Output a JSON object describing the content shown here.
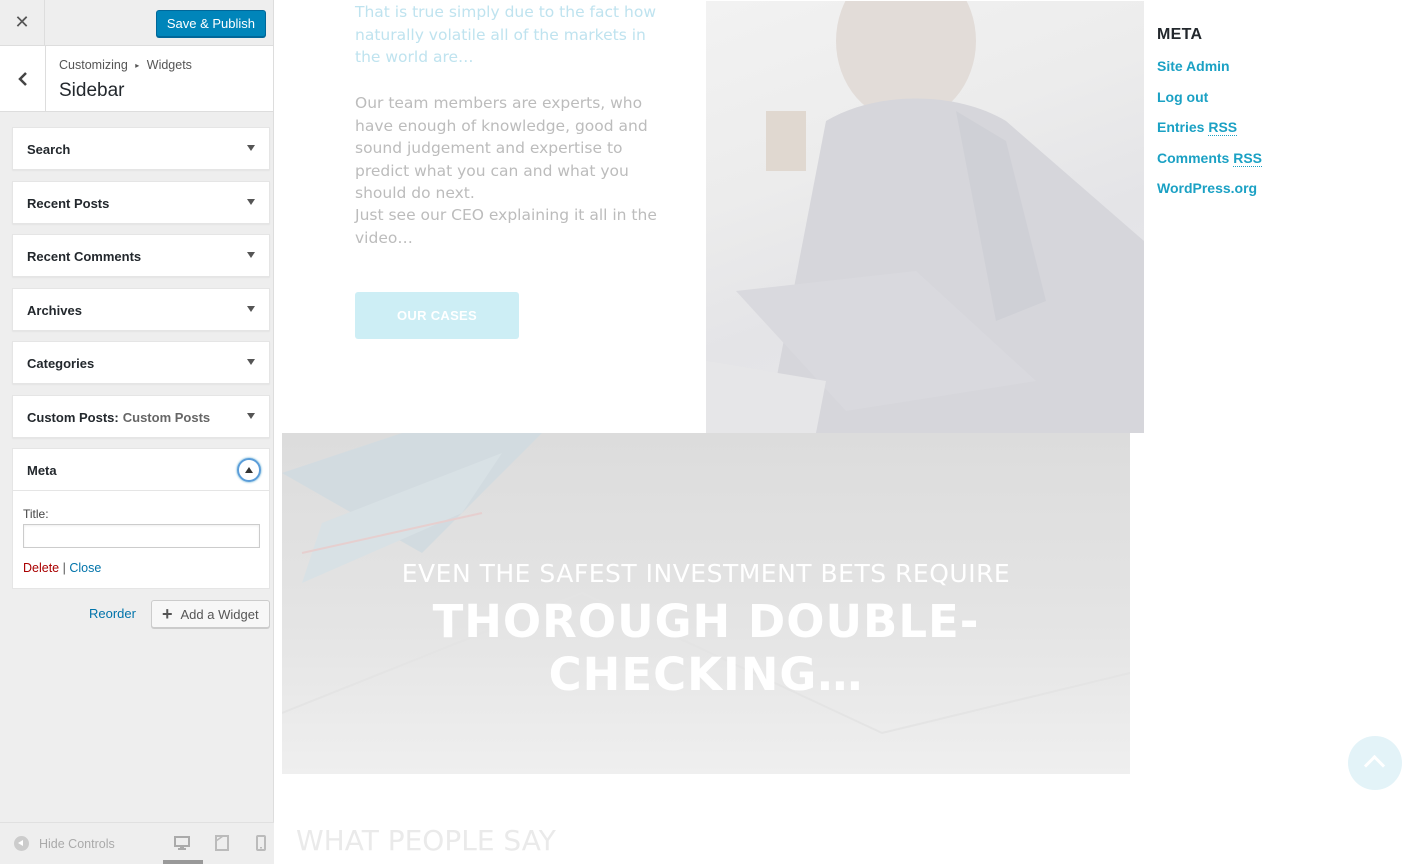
{
  "customizer": {
    "publish_label": "Save & Publish",
    "breadcrumb": {
      "root": "Customizing",
      "separator": "▸",
      "section": "Widgets"
    },
    "section_heading": "Sidebar",
    "widgets": [
      {
        "title": "Search",
        "subtitle": ""
      },
      {
        "title": "Recent Posts",
        "subtitle": ""
      },
      {
        "title": "Recent Comments",
        "subtitle": ""
      },
      {
        "title": "Archives",
        "subtitle": ""
      },
      {
        "title": "Categories",
        "subtitle": ""
      },
      {
        "title": "Custom Posts:",
        "subtitle": "Custom Posts"
      }
    ],
    "meta_widget": {
      "title": "Meta",
      "field_label": "Title:",
      "field_value": "",
      "delete_label": "Delete",
      "divider": "|",
      "close_label": "Close"
    },
    "reorder_label": "Reorder",
    "add_widget_label": "Add a Widget",
    "hide_controls_label": "Hide Controls",
    "accent_color": "#0085ba"
  },
  "preview": {
    "paragraphs": [
      "That is true simply due to the fact how naturally volatile all of the markets in the world are…",
      "Our team members are experts, who have enough of knowledge, good and sound judgement and expertise to predict what you can and what you should do next.",
      "Just see our CEO explaining it all in the video…"
    ],
    "cases_button": "OUR CASES",
    "banner_line1": "EVEN THE SAFEST INVESTMENT BETS REQUIRE",
    "banner_line2": "THOROUGH DOUBLE-CHECKING…",
    "section_heading": "WHAT PEOPLE SAY",
    "meta_heading": "META",
    "meta_links": [
      {
        "text": "Site Admin",
        "abbr": ""
      },
      {
        "text": "Log out",
        "abbr": ""
      },
      {
        "text": "Entries ",
        "abbr": "RSS"
      },
      {
        "text": "Comments ",
        "abbr": "RSS"
      },
      {
        "text": "WordPress.org",
        "abbr": ""
      }
    ],
    "link_color": "#1ba1c4"
  }
}
